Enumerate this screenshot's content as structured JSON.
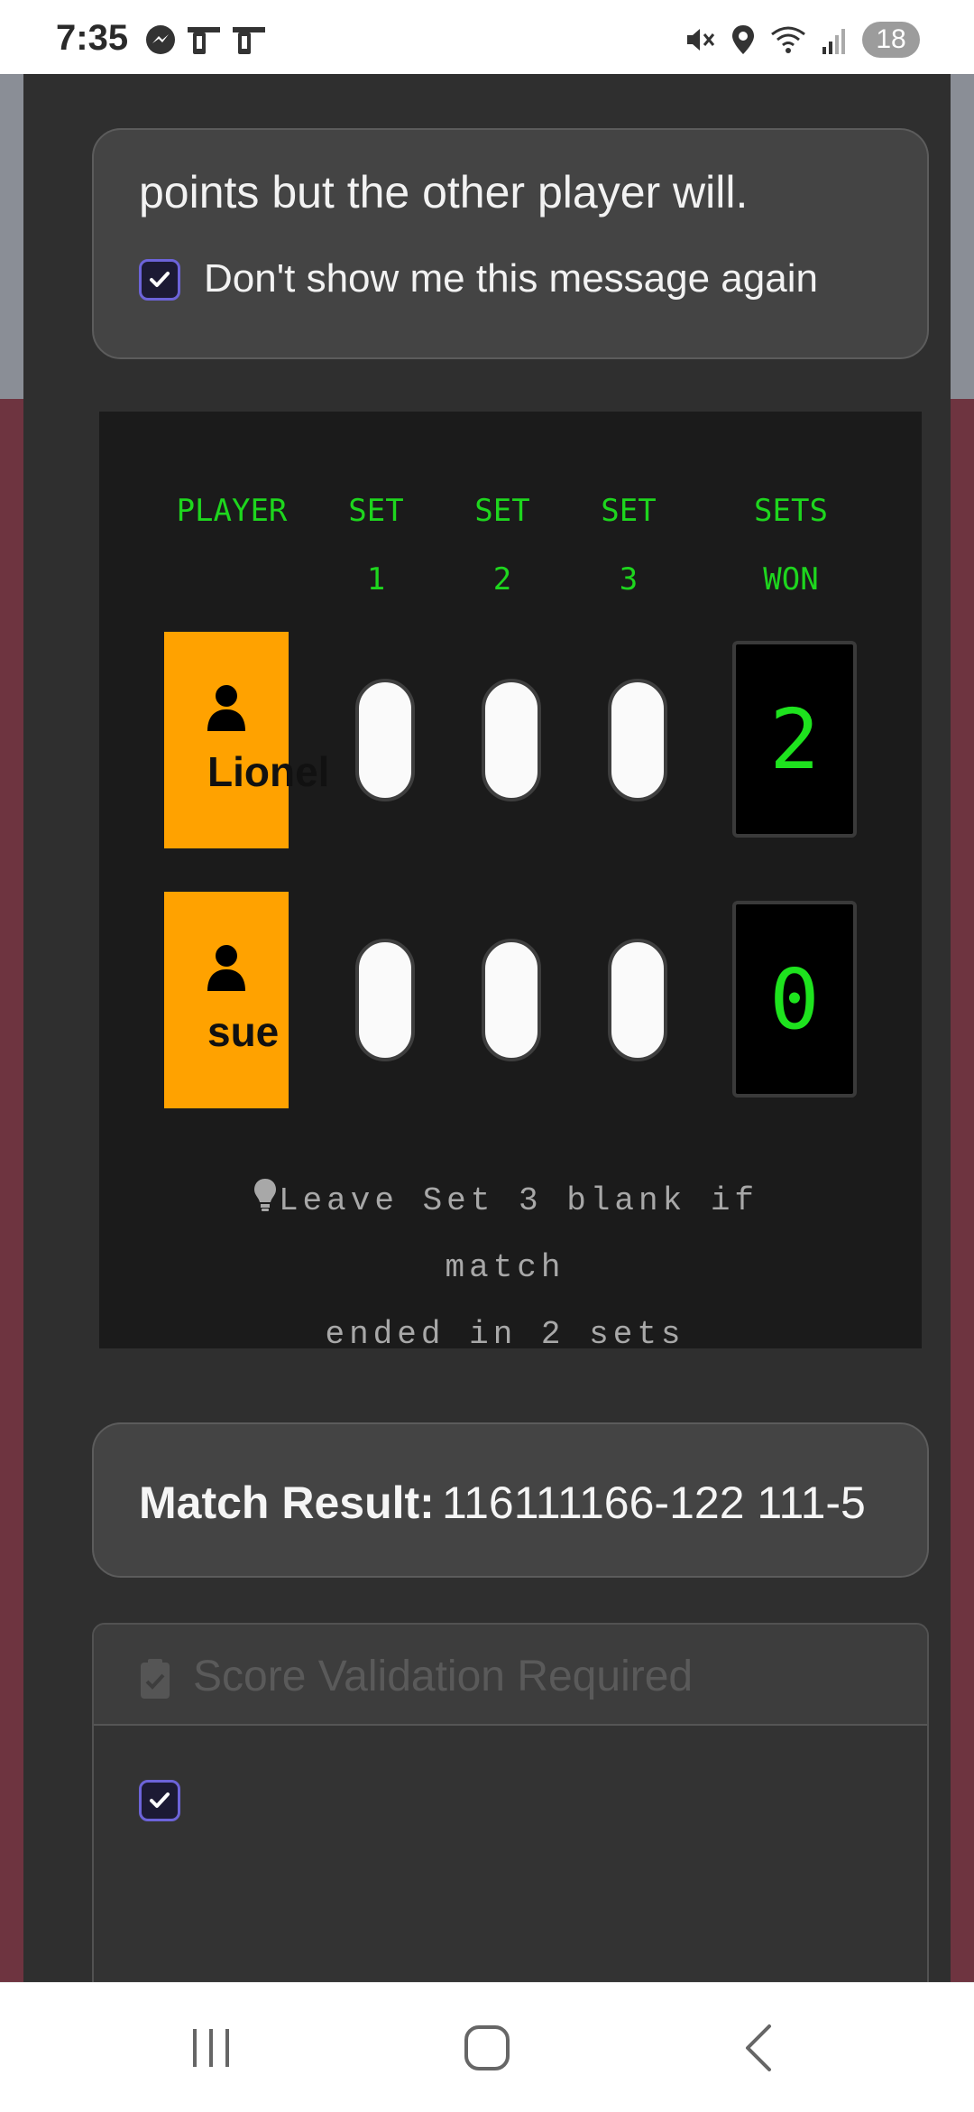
{
  "status_bar": {
    "time": "7:35",
    "badge": "18",
    "left_icons": [
      "messenger-icon",
      "notification-icon",
      "notification-icon"
    ],
    "right_icons": [
      "mute-icon",
      "location-icon",
      "wifi-icon",
      "signal-icon"
    ]
  },
  "info_card": {
    "text": "points but the other player will.",
    "checkbox_label": "Don't show me this message again",
    "checkbox_checked": true
  },
  "scoreboard": {
    "headers": {
      "player": "PLAYER",
      "set1_top": "SET",
      "set1_bottom": "1",
      "set2_top": "SET",
      "set2_bottom": "2",
      "set3_top": "SET",
      "set3_bottom": "3",
      "won_top": "SETS",
      "won_bottom": "WON"
    },
    "players": [
      {
        "name": "Lionel",
        "sets": [
          "",
          "",
          ""
        ],
        "sets_won": "2"
      },
      {
        "name": "sue",
        "sets": [
          "",
          "",
          ""
        ],
        "sets_won": "0"
      }
    ],
    "hint_line1": "Leave Set 3 blank if match",
    "hint_line2": "ended in 2 sets",
    "colors": {
      "accent_green": "#1ed61e",
      "player_card": "#ffa200"
    }
  },
  "match_result": {
    "label": "Match Result:",
    "value": "116111166-122 111-5"
  },
  "validation": {
    "title": "Score Validation Required",
    "checkbox_checked": true
  }
}
